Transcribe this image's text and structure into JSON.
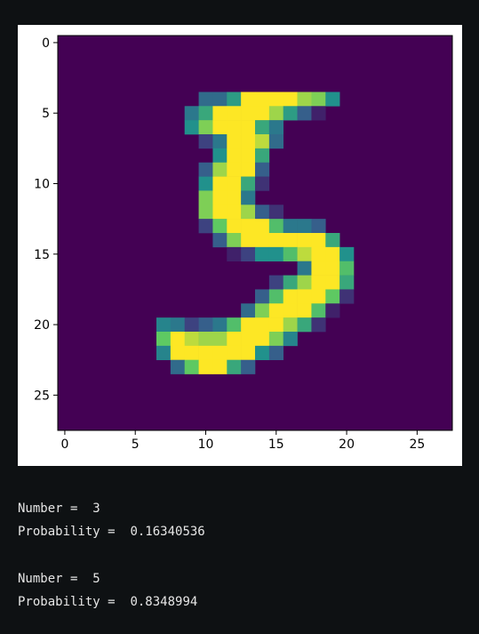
{
  "chart_data": {
    "type": "heatmap",
    "colormap": "viridis",
    "background_value": 0,
    "xticks": [
      0,
      5,
      10,
      15,
      20,
      25
    ],
    "yticks": [
      0,
      5,
      10,
      15,
      20,
      25
    ],
    "xlim": [
      -0.5,
      27.5
    ],
    "ylim": [
      27.5,
      -0.5
    ],
    "rows": 28,
    "cols": 28,
    "pixels": [
      {
        "row": 4,
        "values": [
          [
            10,
            0.35
          ],
          [
            11,
            0.35
          ],
          [
            12,
            0.55
          ],
          [
            13,
            1
          ],
          [
            14,
            1
          ],
          [
            15,
            1
          ],
          [
            16,
            1
          ],
          [
            17,
            0.85
          ],
          [
            18,
            0.8
          ],
          [
            19,
            0.5
          ]
        ]
      },
      {
        "row": 5,
        "values": [
          [
            9,
            0.4
          ],
          [
            10,
            0.6
          ],
          [
            11,
            1
          ],
          [
            12,
            1
          ],
          [
            13,
            1
          ],
          [
            14,
            1
          ],
          [
            15,
            0.85
          ],
          [
            16,
            0.55
          ],
          [
            17,
            0.3
          ],
          [
            18,
            0.1
          ]
        ]
      },
      {
        "row": 6,
        "values": [
          [
            9,
            0.5
          ],
          [
            10,
            0.8
          ],
          [
            11,
            1
          ],
          [
            12,
            1
          ],
          [
            13,
            1
          ],
          [
            14,
            0.6
          ],
          [
            15,
            0.4
          ]
        ]
      },
      {
        "row": 7,
        "values": [
          [
            10,
            0.2
          ],
          [
            11,
            0.4
          ],
          [
            12,
            1
          ],
          [
            13,
            1
          ],
          [
            14,
            0.9
          ],
          [
            15,
            0.35
          ]
        ]
      },
      {
        "row": 8,
        "values": [
          [
            11,
            0.5
          ],
          [
            12,
            1
          ],
          [
            13,
            1
          ],
          [
            14,
            0.6
          ]
        ]
      },
      {
        "row": 9,
        "values": [
          [
            10,
            0.3
          ],
          [
            11,
            0.85
          ],
          [
            12,
            1
          ],
          [
            13,
            1
          ],
          [
            14,
            0.3
          ]
        ]
      },
      {
        "row": 10,
        "values": [
          [
            10,
            0.5
          ],
          [
            11,
            1
          ],
          [
            12,
            1
          ],
          [
            13,
            0.6
          ],
          [
            14,
            0.15
          ]
        ]
      },
      {
        "row": 11,
        "values": [
          [
            10,
            0.8
          ],
          [
            11,
            1
          ],
          [
            12,
            1
          ],
          [
            13,
            0.4
          ]
        ]
      },
      {
        "row": 12,
        "values": [
          [
            10,
            0.8
          ],
          [
            11,
            1
          ],
          [
            12,
            1
          ],
          [
            13,
            0.85
          ],
          [
            14,
            0.3
          ],
          [
            15,
            0.15
          ]
        ]
      },
      {
        "row": 13,
        "values": [
          [
            10,
            0.2
          ],
          [
            11,
            0.75
          ],
          [
            12,
            1
          ],
          [
            13,
            1
          ],
          [
            14,
            1
          ],
          [
            15,
            0.7
          ],
          [
            16,
            0.4
          ],
          [
            17,
            0.4
          ],
          [
            18,
            0.3
          ]
        ]
      },
      {
        "row": 14,
        "values": [
          [
            11,
            0.3
          ],
          [
            12,
            0.8
          ],
          [
            13,
            1
          ],
          [
            14,
            1
          ],
          [
            15,
            1
          ],
          [
            16,
            1
          ],
          [
            17,
            1
          ],
          [
            18,
            1
          ],
          [
            19,
            0.6
          ]
        ]
      },
      {
        "row": 15,
        "values": [
          [
            12,
            0.1
          ],
          [
            13,
            0.2
          ],
          [
            14,
            0.5
          ],
          [
            15,
            0.5
          ],
          [
            16,
            0.7
          ],
          [
            17,
            0.9
          ],
          [
            18,
            1
          ],
          [
            19,
            1
          ],
          [
            20,
            0.5
          ]
        ]
      },
      {
        "row": 16,
        "values": [
          [
            17,
            0.4
          ],
          [
            18,
            1
          ],
          [
            19,
            1
          ],
          [
            20,
            0.7
          ]
        ]
      },
      {
        "row": 17,
        "values": [
          [
            15,
            0.2
          ],
          [
            16,
            0.6
          ],
          [
            17,
            0.85
          ],
          [
            18,
            1
          ],
          [
            19,
            1
          ],
          [
            20,
            0.6
          ]
        ]
      },
      {
        "row": 18,
        "values": [
          [
            14,
            0.3
          ],
          [
            15,
            0.7
          ],
          [
            16,
            1
          ],
          [
            17,
            1
          ],
          [
            18,
            1
          ],
          [
            19,
            0.75
          ],
          [
            20,
            0.15
          ]
        ]
      },
      {
        "row": 19,
        "values": [
          [
            13,
            0.35
          ],
          [
            14,
            0.8
          ],
          [
            15,
            1
          ],
          [
            16,
            1
          ],
          [
            17,
            1
          ],
          [
            18,
            0.7
          ],
          [
            19,
            0.1
          ]
        ]
      },
      {
        "row": 20,
        "values": [
          [
            7,
            0.45
          ],
          [
            8,
            0.4
          ],
          [
            9,
            0.2
          ],
          [
            10,
            0.3
          ],
          [
            11,
            0.4
          ],
          [
            12,
            0.7
          ],
          [
            13,
            1
          ],
          [
            14,
            1
          ],
          [
            15,
            1
          ],
          [
            16,
            0.85
          ],
          [
            17,
            0.6
          ],
          [
            18,
            0.15
          ]
        ]
      },
      {
        "row": 21,
        "values": [
          [
            7,
            0.75
          ],
          [
            8,
            1
          ],
          [
            9,
            0.9
          ],
          [
            10,
            0.85
          ],
          [
            11,
            0.85
          ],
          [
            12,
            1
          ],
          [
            13,
            1
          ],
          [
            14,
            1
          ],
          [
            15,
            0.8
          ],
          [
            16,
            0.45
          ]
        ]
      },
      {
        "row": 22,
        "values": [
          [
            7,
            0.45
          ],
          [
            8,
            1
          ],
          [
            9,
            1
          ],
          [
            10,
            1
          ],
          [
            11,
            1
          ],
          [
            12,
            1
          ],
          [
            13,
            1
          ],
          [
            14,
            0.5
          ],
          [
            15,
            0.3
          ]
        ]
      },
      {
        "row": 23,
        "values": [
          [
            8,
            0.35
          ],
          [
            9,
            0.75
          ],
          [
            10,
            1
          ],
          [
            11,
            1
          ],
          [
            12,
            0.6
          ],
          [
            13,
            0.3
          ]
        ]
      }
    ]
  },
  "results": [
    {
      "label": "Number = ",
      "number": "3",
      "prob_label": "Probability = ",
      "probability": "0.16340536"
    },
    {
      "label": "Number = ",
      "number": "5",
      "prob_label": "Probability = ",
      "probability": "0.8348994"
    }
  ],
  "colors": {
    "page_background": "#0e1113",
    "figure_background": "#ffffff",
    "text": "#e6e6e6"
  }
}
